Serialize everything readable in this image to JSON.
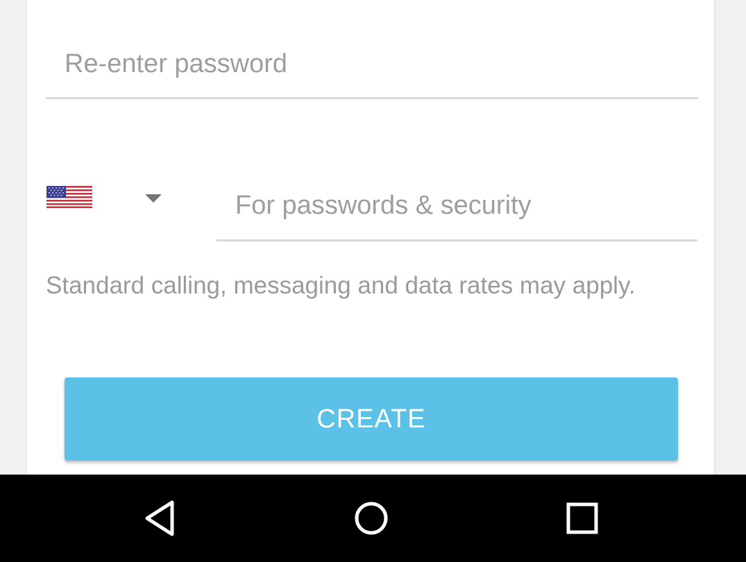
{
  "form": {
    "reenter_password_placeholder": "Re-enter password",
    "phone_placeholder": "For passwords & security",
    "country": {
      "flag_icon": "us-flag-icon",
      "dropdown_icon": "caret-down-icon"
    },
    "disclaimer": "Standard calling, messaging and data rates may apply.",
    "create_label": "CREATE"
  },
  "navbar": {
    "back_icon": "back-triangle-icon",
    "home_icon": "home-circle-icon",
    "recents_icon": "recents-square-icon"
  },
  "colors": {
    "button": "#5bc1e6",
    "placeholder": "#9e9e9e",
    "underline": "#d9d9d9",
    "navbar": "#000000",
    "background": "#f1f1f1"
  }
}
